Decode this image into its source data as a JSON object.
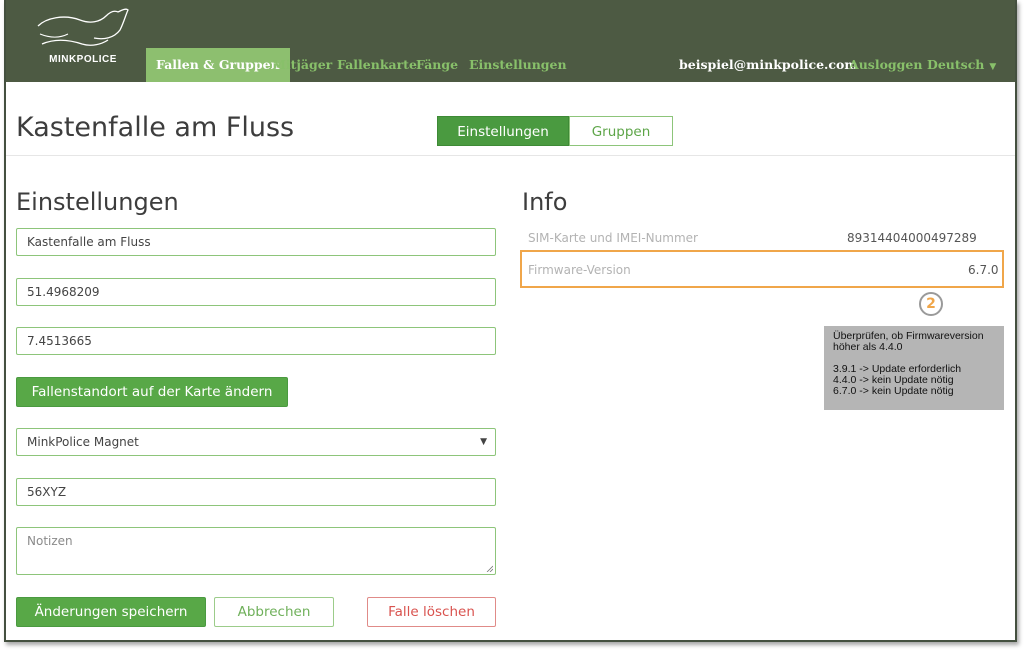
{
  "navbar": {
    "logo_text": "MINKPOLICE",
    "items": [
      {
        "label": "Fallen & Gruppen",
        "active": true
      },
      {
        "label": "Mitjäger"
      },
      {
        "label": "Fallenkarte"
      },
      {
        "label": "Fänge"
      },
      {
        "label": "Einstellungen"
      }
    ],
    "email": "beispiel@minkpolice.com",
    "logout": "Ausloggen",
    "language": "Deutsch"
  },
  "header": {
    "title": "Kastenfalle am Fluss",
    "tabs": [
      {
        "label": "Einstellungen",
        "active": true
      },
      {
        "label": "Gruppen"
      }
    ]
  },
  "settings": {
    "heading": "Einstellungen",
    "name_value": "Kastenfalle am Fluss",
    "latitude_value": "51.4968209",
    "longitude_value": "7.4513665",
    "change_location_label": "Fallenstandort auf der Karte ändern",
    "trap_type_selected": "MinkPolice Magnet",
    "code_value": "56XYZ",
    "notes_placeholder": "Notizen",
    "save_label": "Änderungen speichern",
    "cancel_label": "Abbrechen",
    "delete_label": "Falle löschen"
  },
  "info": {
    "heading": "Info",
    "sim_label": "SIM-Karte und IMEI-Nummer",
    "sim_value": "89314404000497289",
    "firmware_label": "Firmware-Version",
    "firmware_value": "6.7.0"
  },
  "annotation": {
    "badge": "2",
    "note_line1": "Überprüfen, ob Firmwareversion",
    "note_line2": "höher als 4.4.0",
    "note_line3": "3.9.1 -> Update erforderlich",
    "note_line4": "4.4.0 -> kein Update nötig",
    "note_line5": "6.7.0 -> kein Update nötig"
  },
  "colors": {
    "navbar_bg": "#4d5a43",
    "accent_green": "#4a9a40",
    "nav_link": "#88c06a",
    "danger": "#d9534f",
    "highlight": "#f0a64a"
  }
}
